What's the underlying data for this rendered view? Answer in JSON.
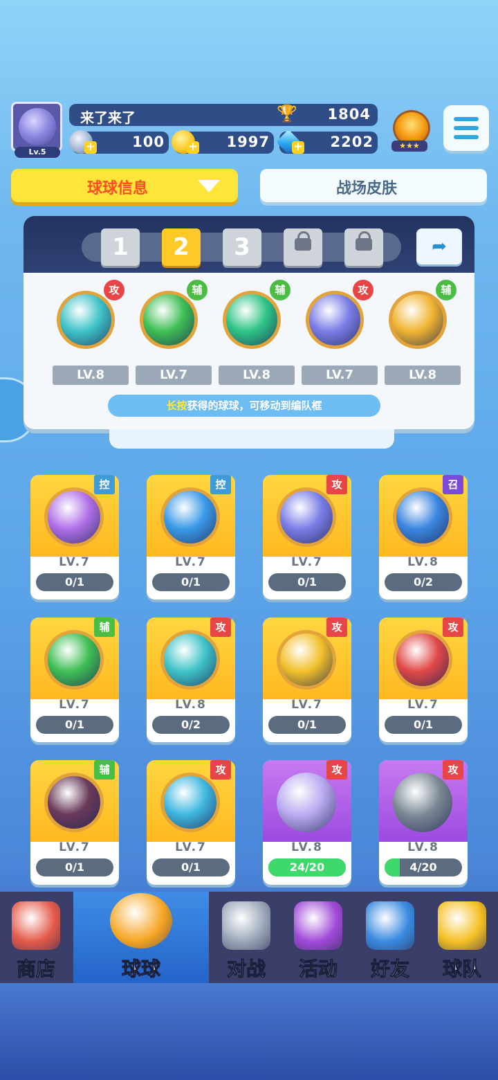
{
  "player": {
    "name": "来了来了",
    "level": "Lv.5",
    "trophies": "1804"
  },
  "currencies": {
    "silver": "100",
    "gold": "1997",
    "gems": "2202"
  },
  "tabs": {
    "active": "球球信息",
    "inactive": "战场皮肤"
  },
  "squad": {
    "slots": [
      "1",
      "2",
      "3"
    ],
    "active_slot": "2",
    "balls": [
      {
        "level": "LV.8",
        "tag": "攻",
        "tag_type": "att",
        "color": "#3fc3c8"
      },
      {
        "level": "LV.7",
        "tag": "辅",
        "tag_type": "sup",
        "color": "#3fbf55"
      },
      {
        "level": "LV.8",
        "tag": "辅",
        "tag_type": "sup",
        "color": "#2ec486"
      },
      {
        "level": "LV.7",
        "tag": "攻",
        "tag_type": "att",
        "color": "#7a7de6"
      },
      {
        "level": "LV.8",
        "tag": "辅",
        "tag_type": "sup",
        "color": "#f0b430"
      }
    ],
    "hint_highlight": "长按",
    "hint_text": "获得的球球，可移动到编队框"
  },
  "collection": [
    {
      "level": "LV.7",
      "progress": "0/1",
      "fraction": 0,
      "tag": "控",
      "tag_type": "ctl",
      "color": "#b070e8",
      "card": "gold"
    },
    {
      "level": "LV.7",
      "progress": "0/1",
      "fraction": 0,
      "tag": "控",
      "tag_type": "ctl",
      "color": "#3a9ae8",
      "card": "gold"
    },
    {
      "level": "LV.7",
      "progress": "0/1",
      "fraction": 0,
      "tag": "攻",
      "tag_type": "att",
      "color": "#7a7de6",
      "card": "gold"
    },
    {
      "level": "LV.8",
      "progress": "0/2",
      "fraction": 0,
      "tag": "召",
      "tag_type": "sum",
      "color": "#3a86e0",
      "card": "gold"
    },
    {
      "level": "LV.7",
      "progress": "0/1",
      "fraction": 0,
      "tag": "辅",
      "tag_type": "sup",
      "color": "#3fbf55",
      "card": "gold"
    },
    {
      "level": "LV.8",
      "progress": "0/2",
      "fraction": 0,
      "tag": "攻",
      "tag_type": "att",
      "color": "#3fc3c8",
      "card": "gold"
    },
    {
      "level": "LV.7",
      "progress": "0/1",
      "fraction": 0,
      "tag": "攻",
      "tag_type": "att",
      "color": "#f2c02a",
      "card": "gold"
    },
    {
      "level": "LV.7",
      "progress": "0/1",
      "fraction": 0,
      "tag": "攻",
      "tag_type": "att",
      "color": "#e04848",
      "card": "gold"
    },
    {
      "level": "LV.7",
      "progress": "0/1",
      "fraction": 0,
      "tag": "辅",
      "tag_type": "sup",
      "color": "#6a3a5a",
      "card": "gold"
    },
    {
      "level": "LV.7",
      "progress": "0/1",
      "fraction": 0,
      "tag": "攻",
      "tag_type": "att",
      "color": "#40b8e0",
      "card": "gold"
    },
    {
      "level": "LV.8",
      "progress": "24/20",
      "fraction": 1,
      "tag": "攻",
      "tag_type": "att",
      "color": "#b8a8f0",
      "card": "purple"
    },
    {
      "level": "LV.8",
      "progress": "4/20",
      "fraction": 0.2,
      "tag": "攻",
      "tag_type": "att",
      "color": "#7a8894",
      "card": "purple"
    }
  ],
  "nav": [
    {
      "label": "商店",
      "icon": "shop-icon",
      "color": "#e45a4a"
    },
    {
      "label": "球球",
      "icon": "ball-jar-icon",
      "color": "#f5a623",
      "active": true
    },
    {
      "label": "对战",
      "icon": "crossed-swords-icon",
      "color": "#9aa6b8"
    },
    {
      "label": "活动",
      "icon": "party-popper-icon",
      "color": "#a04ad8"
    },
    {
      "label": "好友",
      "icon": "friends-book-icon",
      "color": "#3a8ae0"
    },
    {
      "label": "球队",
      "icon": "whistle-icon",
      "color": "#f5c023"
    }
  ]
}
